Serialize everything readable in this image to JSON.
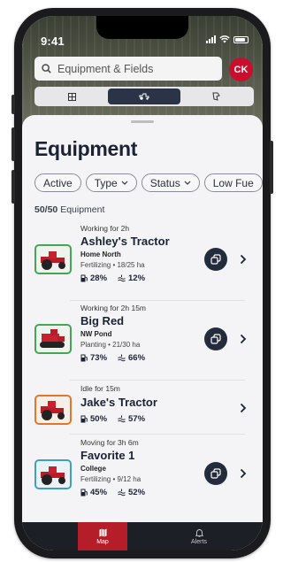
{
  "status_bar": {
    "time": "9:41"
  },
  "search": {
    "placeholder": "Equipment & Fields"
  },
  "user": {
    "initials": "CK"
  },
  "view_segments": [
    {
      "icon": "grid-icon",
      "active": false
    },
    {
      "icon": "tractor-icon",
      "active": true
    },
    {
      "icon": "field-shape-icon",
      "active": false
    }
  ],
  "sheet": {
    "title": "Equipment",
    "filters": [
      "Active",
      "Type",
      "Status",
      "Low Fue"
    ],
    "count": {
      "shown": "50/50",
      "label": "Equipment"
    }
  },
  "equipment": [
    {
      "status": "Working for 2h",
      "name": "Ashley's Tractor",
      "field": "Home North",
      "activity": "Fertilizing • 18/25 ha",
      "fuel": "28%",
      "def": "12%",
      "has_action": true,
      "border_color": "#44a653"
    },
    {
      "status": "Working for 2h 15m",
      "name": "Big Red",
      "field": "NW Pond",
      "activity": "Planting • 21/30 ha",
      "fuel": "73%",
      "def": "66%",
      "has_action": true,
      "border_color": "#44a653"
    },
    {
      "status": "Idle for 15m",
      "name": "Jake's Tractor",
      "field": "",
      "activity": "",
      "fuel": "50%",
      "def": "57%",
      "has_action": false,
      "border_color": "#e0782a"
    },
    {
      "status": "Moving for 3h 6m",
      "name": "Favorite 1",
      "field": "College",
      "activity": "Fertilizing • 9/12 ha",
      "fuel": "45%",
      "def": "52%",
      "has_action": true,
      "border_color": "#3f9fbf"
    }
  ],
  "tabs": {
    "map": "Map",
    "alerts": "Alerts"
  },
  "colors": {
    "brand_red": "#c8102e",
    "navy": "#232c3d"
  }
}
